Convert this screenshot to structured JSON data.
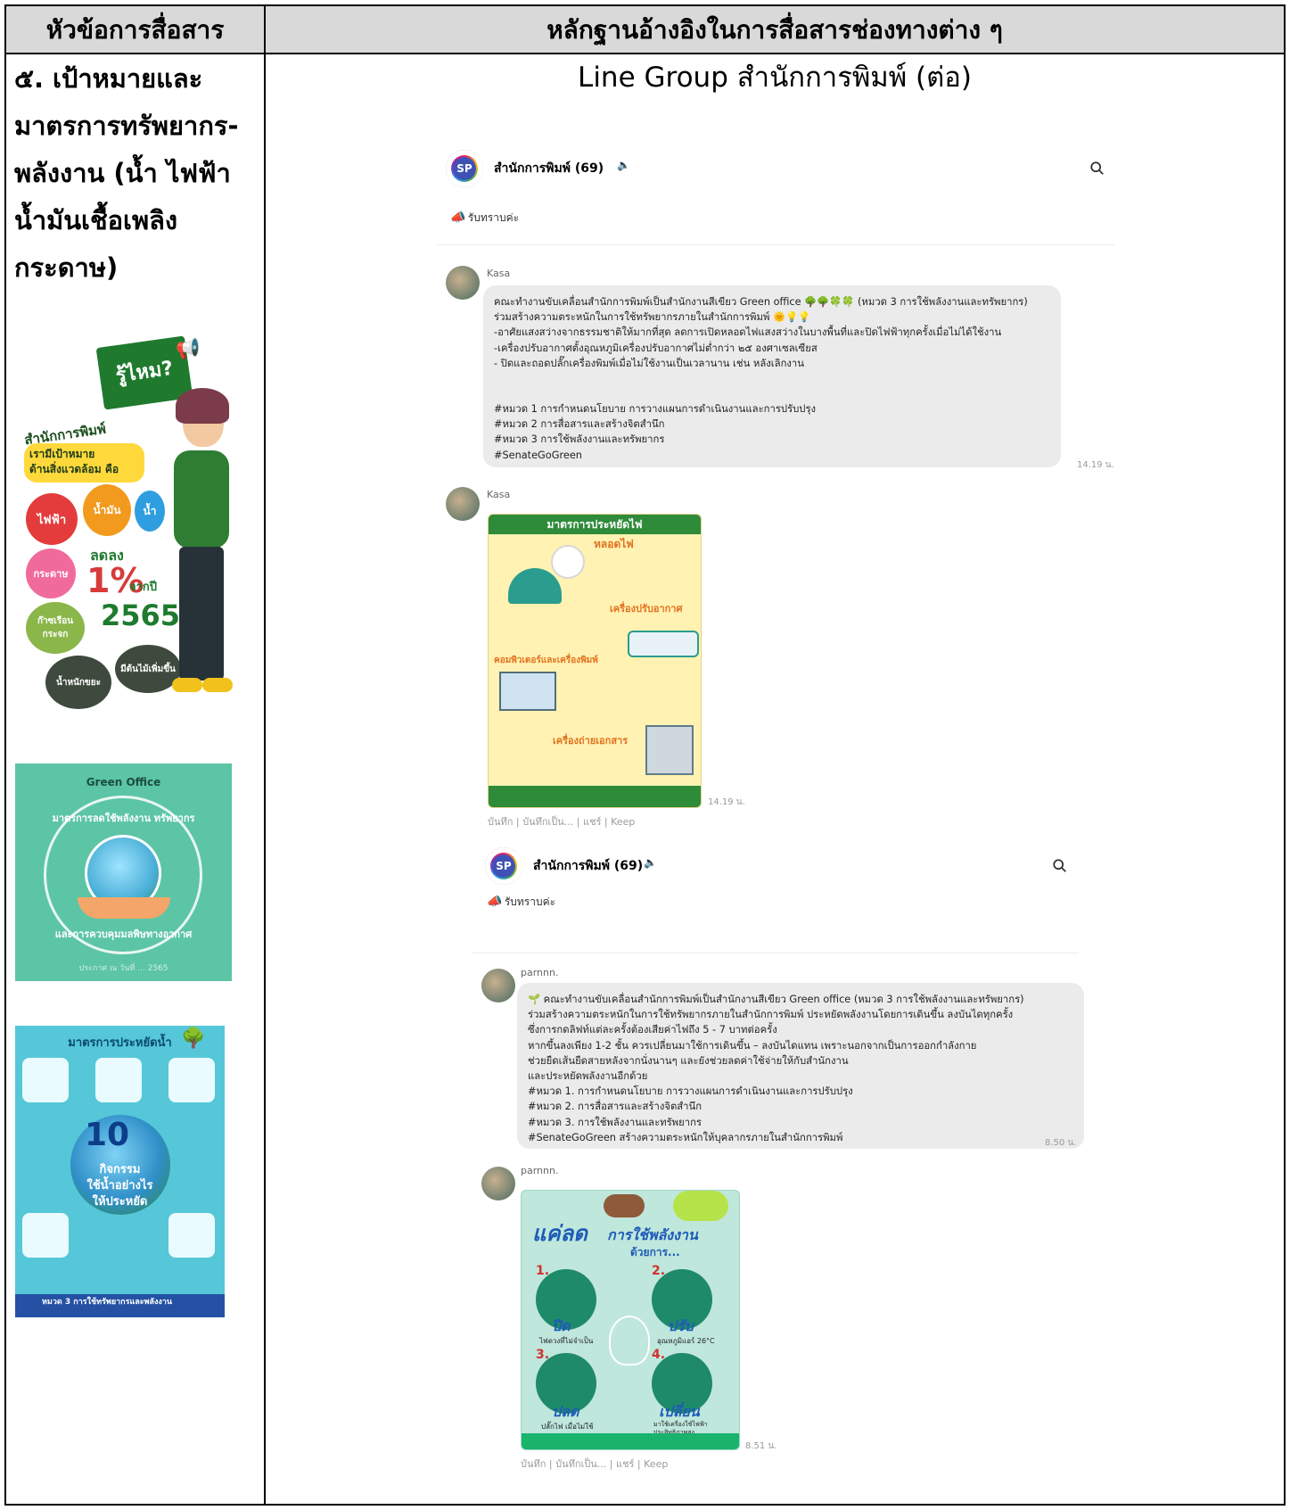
{
  "header": {
    "left": "หัวข้อการสื่อสาร",
    "right": "หลักฐานอ้างอิงในการสื่อสารช่องทางต่าง ๆ"
  },
  "topic": {
    "lines": [
      "๕. เป้าหมายและ",
      "มาตรการทรัพยากร-",
      "พลังงาน (น้ำ ไฟฟ้า",
      "น้ำมันเชื้อเพลิง",
      "กระดาษ)"
    ]
  },
  "evidence_title": "Line Group สำนักการพิมพ์ (ต่อ)",
  "posters": {
    "p1": {
      "badge": "รู้ไหม?",
      "office": "สำนักการพิมพ์",
      "goal1": "เรามีเป้าหมาย",
      "goal2": "ด้านสิ่งแวดล้อม คือ",
      "b_electric": "ไฟฟ้า",
      "b_fuel": "น้ำมัน",
      "b_water": "น้ำ",
      "b_paper": "กระดาษ",
      "b_waste": "ก๊าซเรือนกระจก",
      "reduce": "ลดลง",
      "percent": "1%",
      "from_year": "จากปี",
      "year": "2565",
      "b_recycle": "น้ำหนักขยะ",
      "b_more": "มีต้นไม้เพิ่มขึ้น"
    },
    "p2": {
      "brand": "Green Office",
      "arc_top": "มาตรการลดใช้พลังงาน ทรัพยากร",
      "arc_bottom": "และการควบคุมมลพิษทางอากาศ",
      "footer": "ประกาศ ณ วันที่ ... 2565"
    },
    "p3": {
      "title": "มาตรการประหยัดน้ำ",
      "big": "10",
      "line1": "กิจกรรม",
      "line2": "ใช้น้ำอย่างไร",
      "line3": "ให้ประหยัด",
      "footer": "หมวด 3 การใช้ทรัพยากรและพลังงาน"
    }
  },
  "chat1": {
    "group": "สำนักการพิมพ์ (69)",
    "announcement": "รับทราบค่ะ",
    "msg1": {
      "sender": "Kasa",
      "lines": [
        "คณะทำงานขับเคลื่อนสำนักการพิมพ์เป็นสำนักงานสีเขียว Green office 🌳🌳🍀🍀 (หมวด 3 การใช้พลังงานและทรัพยากร)",
        "ร่วมสร้างความตระหนักในการใช้ทรัพยากรภายในสำนักการพิมพ์ 🌞💡💡",
        "-อาศัยแสงสว่างจากธรรมชาติให้มากที่สุด ลดการเปิดหลอดไฟแสงสว่างในบางพื้นที่และปิดไฟฟ้าทุกครั้งเมื่อไม่ได้ใช้งาน",
        "-เครื่องปรับอากาศตั้งอุณหภูมิเครื่องปรับอากาศไม่ต่ำกว่า ๒๕ องศาเซลเซียส",
        "- ปิดและถอดปลั๊กเครื่องพิมพ์เมื่อไม่ใช้งานเป็นเวลานาน เช่น หลังเลิกงาน",
        "",
        "#หมวด 1 การกำหนดนโยบาย การวางแผนการดำเนินงานและการปรับปรุง",
        "#หมวด 2 การสื่อสารและสร้างจิตสำนึก",
        "#หมวด 3 การใช้พลังงานและทรัพยากร",
        "#SenateGoGreen"
      ],
      "time": "14.19 น."
    },
    "msg2": {
      "sender": "Kasa",
      "img_title": "มาตรการประหยัดไฟ",
      "img_s1": "หลอดไฟ",
      "img_s2": "เครื่องปรับอากาศ",
      "img_s3": "คอมพิวเตอร์และเครื่องพิมพ์",
      "img_s4": "เครื่องถ่ายเอกสาร",
      "time": "14.19 น.",
      "actions": "บันทึก | บันทึกเป็น... | แชร์ | Keep"
    }
  },
  "chat2": {
    "group": "สำนักการพิมพ์ (69)",
    "announcement": "รับทราบค่ะ",
    "msg1": {
      "sender": "parnnn.",
      "lines": [
        "🌱 คณะทำงานขับเคลื่อนสำนักการพิมพ์เป็นสำนักงานสีเขียว Green office (หมวด 3 การใช้พลังงานและทรัพยากร)",
        "ร่วมสร้างความตระหนักในการใช้ทรัพยากรภายในสำนักการพิมพ์ ประหยัดพลังงานโดยการเดินขึ้น ลงบันไดทุกครั้ง",
        "ซึ่งการกดลิฟท์แต่ละครั้งต้องเสียค่าไฟถึง 5 - 7 บาทต่อครั้ง",
        "หากขึ้นลงเพียง 1-2 ชั้น ควรเปลี่ยนมาใช้การเดินขึ้น – ลงบันไดแทน เพราะนอกจากเป็นการออกกำลังกาย",
        "ช่วยยืดเส้นยืดสายหลังจากนั่งนานๆ และยังช่วยลดค่าใช้จ่ายให้กับสำนักงาน",
        "และประหยัดพลังงานอีกด้วย",
        "#หมวด 1. การกำหนดนโยบาย การวางแผนการดำเนินงานและการปรับปรุง",
        "#หมวด 2. การสื่อสารและสร้างจิตสำนึก",
        "#หมวด 3. การใช้พลังงานและทรัพยากร",
        "#SenateGoGreen สร้างความตระหนักให้บุคลากรภายในสำนักการพิมพ์"
      ],
      "time": "8.50 น."
    },
    "msg2": {
      "sender": "parnnn.",
      "img_title1": "แค่ลด",
      "img_title2": "การใช้พลังงาน",
      "img_sub": "ด้วยการ...",
      "i1_num": "1.",
      "i1": "ปิด",
      "i1_sub": "ไฟดวงที่ไม่จำเป็น",
      "i2_num": "2.",
      "i2": "ปรับ",
      "i2_sub": "อุณหภูมิแอร์ 26°C",
      "i3_num": "3.",
      "i3": "ปลด",
      "i3_sub": "ปลั๊กไฟ เมื่อไม่ใช้",
      "i4_num": "4.",
      "i4": "เปลี่ยน",
      "i4_sub": "มาใช้เครื่องใช้ไฟฟ้าประสิทธิภาพสูง",
      "time": "8.51 น.",
      "actions": "บันทึก | บันทึกเป็น... | แชร์ | Keep"
    }
  }
}
